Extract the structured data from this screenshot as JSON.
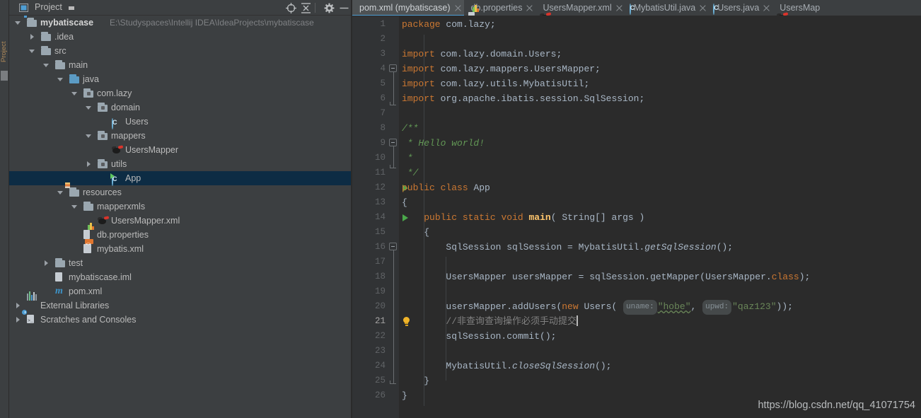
{
  "window": {
    "left_strip_label": "Project"
  },
  "project_panel": {
    "title": "Project",
    "icons": {
      "window_icon": "project-window-icon",
      "dropdown": "chevron-down-icon",
      "locate": "crosshair-locate-icon",
      "collapse_all": "collapse-all-icon",
      "settings": "gear-icon",
      "hide": "minimize-icon"
    },
    "tree": [
      {
        "label": "mybatiscase",
        "path": "E:\\Studyspaces\\Intellij IDEA\\IdeaProjects\\mybatiscase",
        "depth": 0,
        "arrow": "down",
        "icon": "module-folder-icon",
        "bold": true,
        "selected": false
      },
      {
        "label": ".idea",
        "depth": 1,
        "arrow": "right",
        "icon": "folder-icon",
        "selected": false
      },
      {
        "label": "src",
        "depth": 1,
        "arrow": "down",
        "icon": "folder-icon",
        "selected": false
      },
      {
        "label": "main",
        "depth": 2,
        "arrow": "down",
        "icon": "folder-icon",
        "selected": false
      },
      {
        "label": "java",
        "depth": 3,
        "arrow": "down",
        "icon": "source-folder-icon",
        "selected": false
      },
      {
        "label": "com.lazy",
        "depth": 4,
        "arrow": "down",
        "icon": "package-icon",
        "selected": false
      },
      {
        "label": "domain",
        "depth": 5,
        "arrow": "down",
        "icon": "package-icon",
        "selected": false
      },
      {
        "label": "Users",
        "depth": 6,
        "arrow": "none",
        "icon": "java-class-icon",
        "selected": false
      },
      {
        "label": "mappers",
        "depth": 5,
        "arrow": "down",
        "icon": "package-icon",
        "selected": false
      },
      {
        "label": "UsersMapper",
        "depth": 6,
        "arrow": "none",
        "icon": "mybatis-mapper-icon",
        "selected": false
      },
      {
        "label": "utils",
        "depth": 5,
        "arrow": "right",
        "icon": "package-icon",
        "selected": false
      },
      {
        "label": "App",
        "depth": 6,
        "arrow": "none",
        "icon": "java-runnable-class-icon",
        "selected": true
      },
      {
        "label": "resources",
        "depth": 3,
        "arrow": "down",
        "icon": "resources-folder-icon",
        "selected": false
      },
      {
        "label": "mapperxmls",
        "depth": 4,
        "arrow": "down",
        "icon": "folder-icon",
        "selected": false
      },
      {
        "label": "UsersMapper.xml",
        "depth": 5,
        "arrow": "none",
        "icon": "mybatis-mapper-icon",
        "selected": false
      },
      {
        "label": "db.properties",
        "depth": 4,
        "arrow": "none",
        "icon": "properties-file-icon",
        "selected": false
      },
      {
        "label": "mybatis.xml",
        "depth": 4,
        "arrow": "none",
        "icon": "xml-file-icon",
        "selected": false
      },
      {
        "label": "test",
        "depth": 2,
        "arrow": "right",
        "icon": "folder-icon",
        "selected": false
      },
      {
        "label": "mybatiscase.iml",
        "depth": 2,
        "arrow": "none",
        "icon": "iml-file-icon",
        "selected": false
      },
      {
        "label": "pom.xml",
        "depth": 2,
        "arrow": "none",
        "icon": "maven-pom-icon",
        "selected": false
      },
      {
        "label": "External Libraries",
        "depth": 0,
        "arrow": "right",
        "icon": "external-libraries-icon",
        "selected": false
      },
      {
        "label": "Scratches and Consoles",
        "depth": 0,
        "arrow": "right",
        "icon": "scratches-icon",
        "selected": false
      }
    ]
  },
  "editor": {
    "tabs": [
      {
        "label": "pom.xml (mybatiscase)",
        "icon": "maven-pom-icon",
        "active": true,
        "closable": true
      },
      {
        "label": "db.properties",
        "icon": "properties-file-icon",
        "active": false,
        "closable": true
      },
      {
        "label": "UsersMapper.xml",
        "icon": "mybatis-mapper-icon",
        "active": false,
        "closable": true
      },
      {
        "label": "MybatisUtil.java",
        "icon": "java-class-icon",
        "active": false,
        "closable": true
      },
      {
        "label": "Users.java",
        "icon": "java-class-icon",
        "active": false,
        "closable": true
      },
      {
        "label": "UsersMap",
        "icon": "mybatis-mapper-icon",
        "active": false,
        "closable": false
      }
    ],
    "lines": [
      {
        "n": 1,
        "current": false
      },
      {
        "n": 2,
        "current": false
      },
      {
        "n": 3,
        "current": false
      },
      {
        "n": 4,
        "current": false
      },
      {
        "n": 5,
        "current": false
      },
      {
        "n": 6,
        "current": false
      },
      {
        "n": 7,
        "current": false
      },
      {
        "n": 8,
        "current": false
      },
      {
        "n": 9,
        "current": false
      },
      {
        "n": 10,
        "current": false
      },
      {
        "n": 11,
        "current": false
      },
      {
        "n": 12,
        "current": false,
        "run_arrow": true
      },
      {
        "n": 13,
        "current": false
      },
      {
        "n": 14,
        "current": false,
        "run_arrow": true
      },
      {
        "n": 15,
        "current": false
      },
      {
        "n": 16,
        "current": false
      },
      {
        "n": 17,
        "current": false
      },
      {
        "n": 18,
        "current": false
      },
      {
        "n": 19,
        "current": false
      },
      {
        "n": 20,
        "current": false
      },
      {
        "n": 21,
        "current": true,
        "bulb": true
      },
      {
        "n": 22,
        "current": false
      },
      {
        "n": 23,
        "current": false
      },
      {
        "n": 24,
        "current": false
      },
      {
        "n": 25,
        "current": false
      },
      {
        "n": 26,
        "current": false
      }
    ],
    "code_text": {
      "l1": "package com.lazy;",
      "l3": "import com.lazy.domain.Users;",
      "l4": "import com.lazy.mappers.UsersMapper;",
      "l5": "import com.lazy.utils.MybatisUtil;",
      "l6": "import org.apache.ibatis.session.SqlSession;",
      "l8": "/**",
      "l9": " * Hello world!",
      "l10": " *",
      "l11": " */",
      "l12": "public class App",
      "l13": "{",
      "l14": "    public static void main( String[] args )",
      "l15": "    {",
      "l16": "        SqlSession sqlSession = MybatisUtil.getSqlSession();",
      "l18": "        UsersMapper usersMapper = sqlSession.getMapper(UsersMapper.class);",
      "l20": "        usersMapper.addUsers(new Users( uname: \"hobe\", upwd: \"qaz123\"));",
      "l21": "        //非查询查询操作必须手动提交",
      "l22": "        sqlSession.commit();",
      "l24": "        MybatisUtil.closeSqlSession();",
      "l25": "    }",
      "l26": "}",
      "hint_uname": "uname:",
      "hint_upwd": "upwd:",
      "str_hobe": "\"hobe\"",
      "str_qaz": "\"qaz123\""
    }
  },
  "watermark": "https://blog.csdn.net/qq_41071754",
  "colors": {
    "panel_bg": "#3c3f41",
    "editor_bg": "#2b2b2b",
    "gutter_bg": "#313335",
    "selection": "#0d2c44",
    "accent": "#4f9ed4",
    "keyword": "#cc7832",
    "string": "#6a8759",
    "comment": "#629755",
    "line_comment": "#808080",
    "method": "#ffc66d",
    "run_green": "#4aa84a",
    "bulb": "#f0b429"
  }
}
